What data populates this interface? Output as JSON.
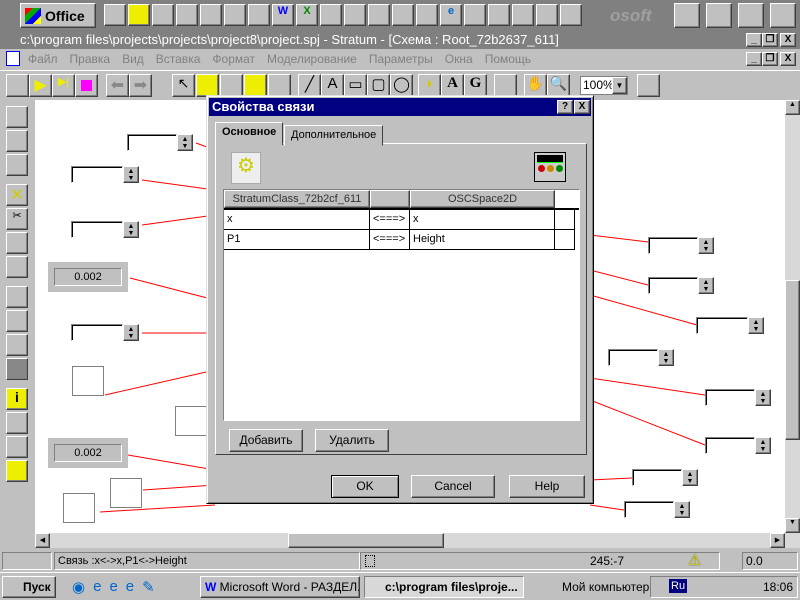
{
  "office_bar": {
    "label": "Office",
    "brand_fragment": "osoft"
  },
  "window": {
    "title": "c:\\program files\\projects\\projects\\project8\\project.spj - Stratum - [Схема : Root_72b2637_611]"
  },
  "menu": [
    "Файл",
    "Правка",
    "Вид",
    "Вставка",
    "Формат",
    "Моделирование",
    "Параметры",
    "Окна",
    "Помощь"
  ],
  "toolbar": {
    "zoom": "100%"
  },
  "canvas": {
    "value_boxes": [
      "0.002",
      "0.002"
    ]
  },
  "dialog": {
    "title": "Свойства связи",
    "help": "?",
    "close": "X",
    "tabs": [
      "Основное",
      "Дополнительное"
    ],
    "columns": [
      "StratumClass_72b2cf_611",
      "",
      "OSCSpace2D"
    ],
    "rows": [
      {
        "left": "x",
        "arrow": "<===>",
        "right": "x"
      },
      {
        "left": "P1",
        "arrow": "<===>",
        "right": "Height"
      }
    ],
    "add": "Добавить",
    "remove": "Удалить",
    "ok": "OK",
    "cancel": "Cancel",
    "help_btn": "Help"
  },
  "status": {
    "text": "Связь :x<->x,P1<->Height",
    "coords": "245:-7",
    "value": "0.0"
  },
  "taskbar": {
    "start": "Пуск",
    "tasks": [
      "Microsoft Word - РАЗДЕЛ...",
      "c:\\program files\\proje..."
    ],
    "tray_label": "Мой компьютер",
    "lang": "Ru",
    "clock": "18:06"
  }
}
